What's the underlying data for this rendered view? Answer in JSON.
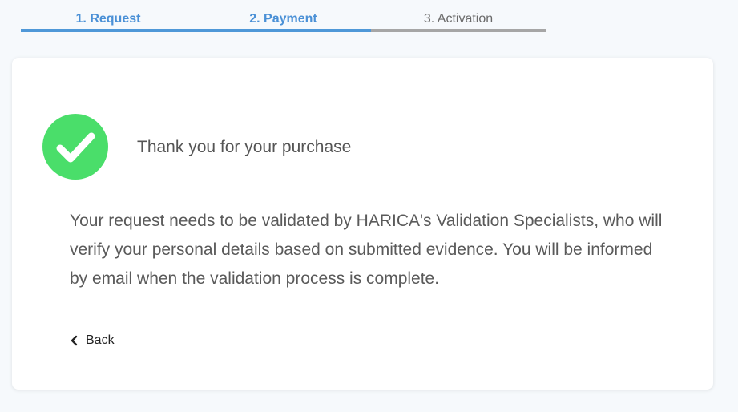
{
  "stepper": {
    "steps": [
      {
        "label": "1. Request",
        "state": "complete"
      },
      {
        "label": "2. Payment",
        "state": "complete"
      },
      {
        "label": "3. Activation",
        "state": "pending"
      }
    ]
  },
  "card": {
    "icon": "check-circle-icon",
    "heading": "Thank you for your purchase",
    "message": "Your request needs to be validated by HARICA's Validation Specialists, who will verify your personal details based on submitted evidence. You will be informed by email when the validation process is complete.",
    "back_label": "Back"
  },
  "colors": {
    "accent": "#4f98d8",
    "success": "#4ade6a",
    "pending": "#a6a6a6"
  }
}
